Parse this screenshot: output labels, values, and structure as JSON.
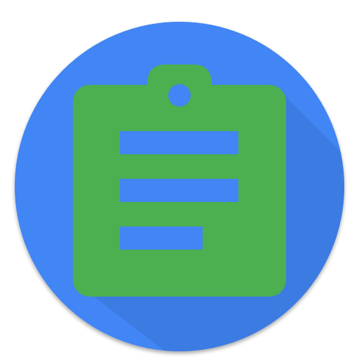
{
  "icon": {
    "name": "clipboard-icon",
    "colors": {
      "circle": "#4285f4",
      "long_shadow": "#3b78dc",
      "clipboard": "#4caf50",
      "clipboard_shadow": "#3d8b40",
      "text_lines": "#4285f4",
      "page_background": "#ffffff"
    },
    "text_line_count": 3
  }
}
